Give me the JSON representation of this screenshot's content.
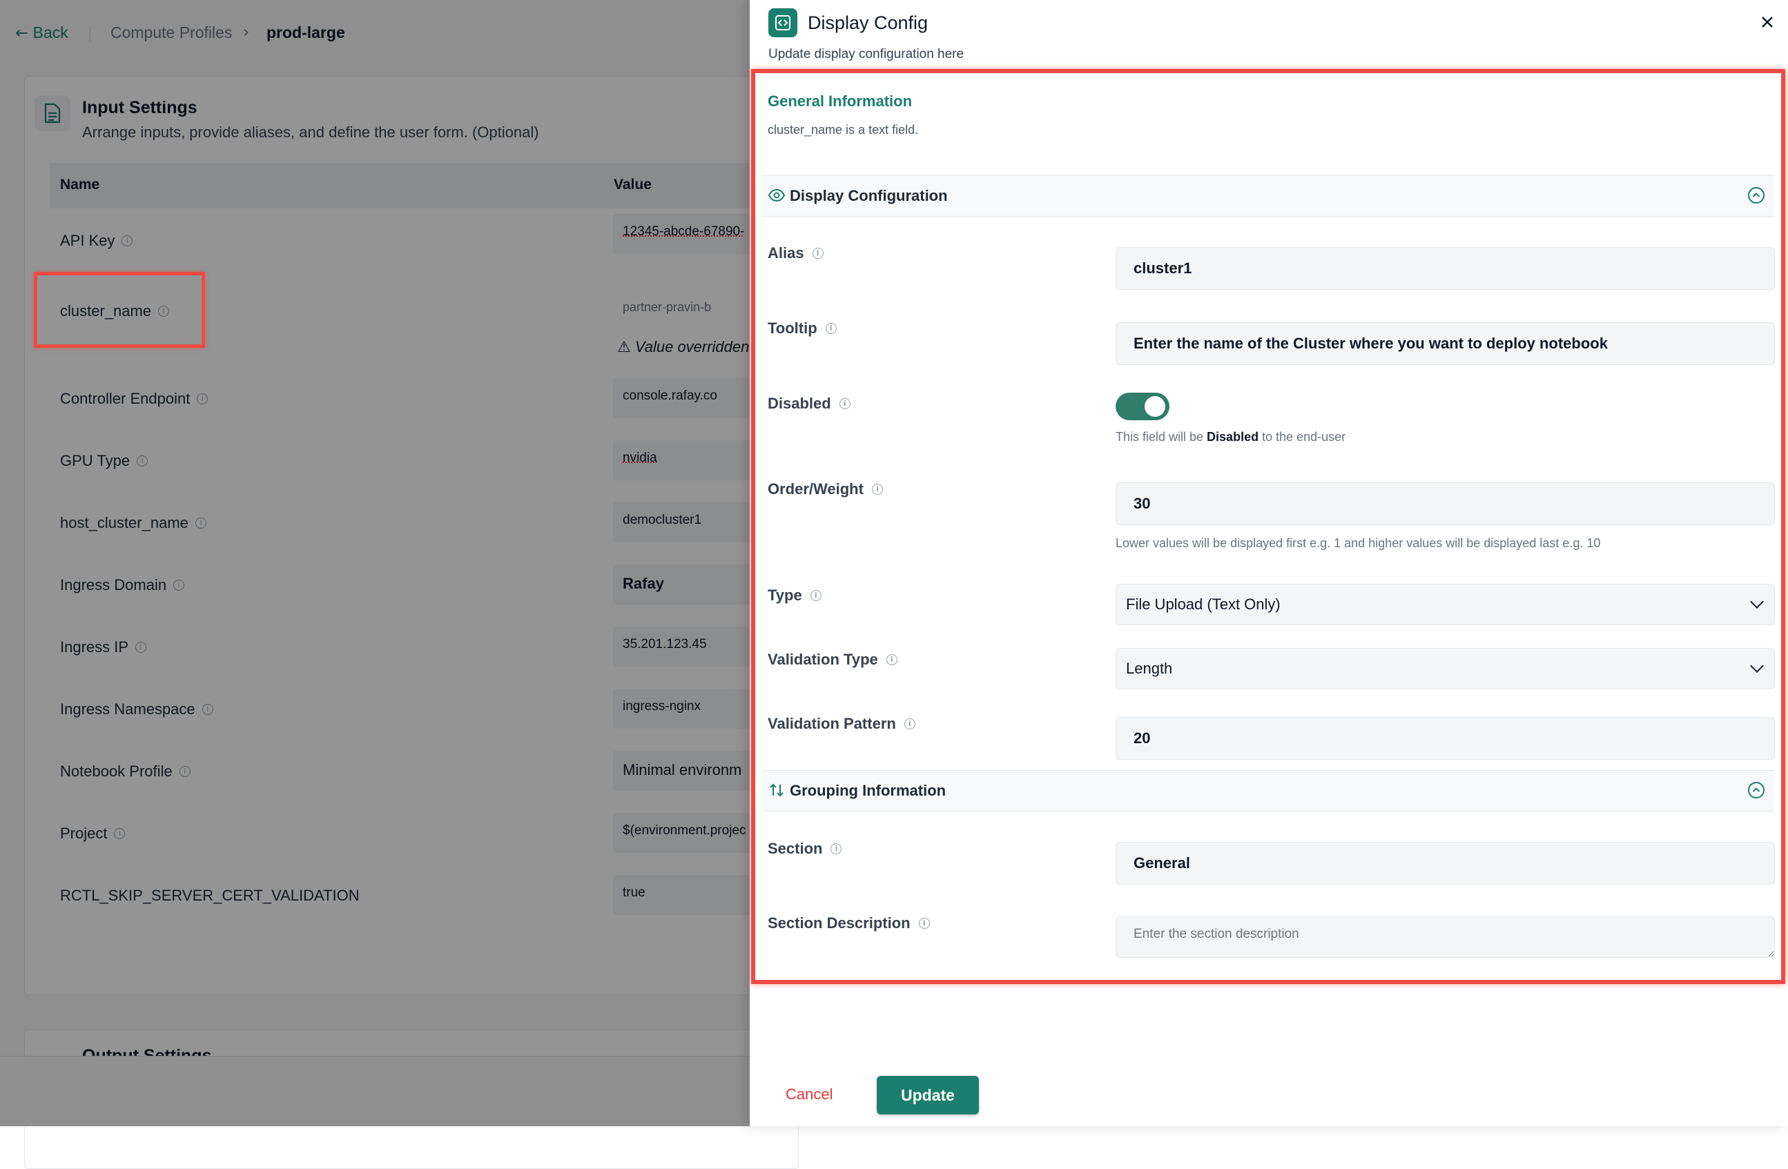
{
  "breadcrumb": {
    "back": "Back",
    "parent": "Compute Profiles",
    "current": "prod-large"
  },
  "input_settings": {
    "title": "Input Settings",
    "subtitle": "Arrange inputs, provide aliases, and define the user form. (Optional)",
    "col_name": "Name",
    "col_value": "Value",
    "rows": [
      {
        "name": "API Key",
        "value": "12345-abcde-67890-"
      },
      {
        "name": "cluster_name",
        "value": "partner-pravin-b",
        "note": "Value overridden"
      },
      {
        "name": "Controller Endpoint",
        "value": "console.rafay.co"
      },
      {
        "name": "GPU Type",
        "value": "nvidia"
      },
      {
        "name": "host_cluster_name",
        "value": "democluster1"
      },
      {
        "name": "Ingress Domain",
        "value": "Rafay"
      },
      {
        "name": "Ingress IP",
        "value": "35.201.123.45"
      },
      {
        "name": "Ingress Namespace",
        "value": "ingress-nginx"
      },
      {
        "name": "Notebook Profile",
        "value": "Minimal environm"
      },
      {
        "name": "Project",
        "value": "$(environment.projec"
      },
      {
        "name": "RCTL_SKIP_SERVER_CERT_VALIDATION",
        "value": "true"
      }
    ],
    "output_title": "Output Settings"
  },
  "drawer": {
    "title": "Display Config",
    "subtitle": "Update display configuration here",
    "general_title": "General Information",
    "general_desc": "cluster_name is a text field.",
    "display_section": "Display Configuration",
    "alias_label": "Alias",
    "alias_value": "cluster1",
    "tooltip_label": "Tooltip",
    "tooltip_value": "Enter the name of the Cluster where you want to deploy notebook",
    "disabled_label": "Disabled",
    "disabled_help_pre": "This field will be ",
    "disabled_help_bold": "Disabled",
    "disabled_help_post": " to the end-user",
    "disabled_on": 1,
    "order_label": "Order/Weight",
    "order_value": "30",
    "order_help": "Lower values will be displayed first e.g. 1 and higher values will be displayed last e.g. 10",
    "type_label": "Type",
    "type_value": "File Upload (Text Only)",
    "validation_type_label": "Validation Type",
    "validation_type_value": "Length",
    "validation_pattern_label": "Validation Pattern",
    "validation_pattern_value": "20",
    "grouping_section": "Grouping Information",
    "section_label": "Section",
    "section_value": "General",
    "section_desc_label": "Section Description",
    "section_desc_placeholder": "Enter the section description",
    "cancel": "Cancel",
    "update": "Update"
  },
  "colors": {
    "accent": "#1a7f6e",
    "highlight": "#ef4b43",
    "cancel": "#e53935"
  }
}
